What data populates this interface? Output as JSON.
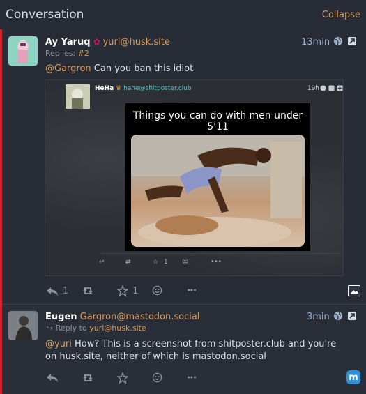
{
  "header": {
    "title": "Conversation",
    "collapse_label": "Collapse"
  },
  "colors": {
    "accent_red": "#d7262f",
    "link_orange": "#d59b5a",
    "mastodon_blue": "#2b90d9"
  },
  "status1": {
    "display_name": "Ay Yaruq",
    "handle": "yuri@husk.site",
    "replies_label": "Replies:",
    "replies_link": "#2",
    "time": "13min",
    "mention": "@Gargron",
    "text": " Can you ban this idiot",
    "actions": {
      "reply_count": "1",
      "fav_count": "1"
    },
    "embed": {
      "display_name": "HeHa",
      "handle": "hehe@shitposter.club",
      "time": "19h",
      "caption": "Things you can do with men under 5'11",
      "fav_count": "1"
    }
  },
  "status2": {
    "display_name": "Eugen",
    "handle": "Gargron@mastodon.social",
    "time": "3min",
    "reply_to_label": "Reply to",
    "reply_to_handle": "yuri@husk.site",
    "mention": "@yuri",
    "text": " How? This is a screenshot from shitposter.club and you're on husk.site, neither of which is mastodon.social",
    "badge_glyph": "m"
  }
}
